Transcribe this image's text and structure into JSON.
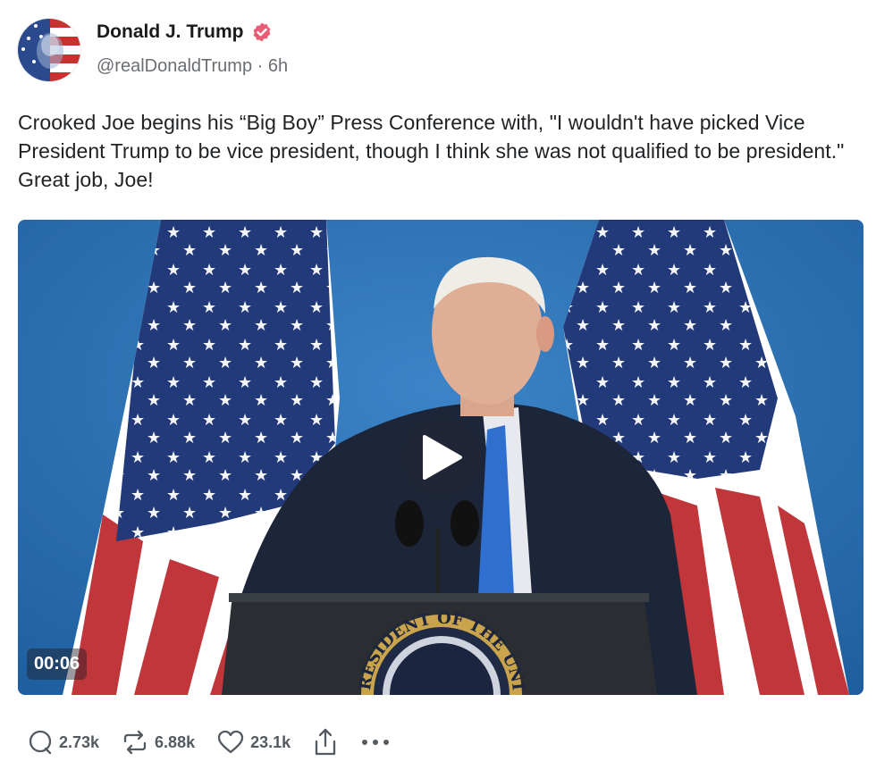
{
  "post": {
    "author_name": "Donald J. Trump",
    "handle": "@realDonaldTrump",
    "separator": "·",
    "time_ago": "6h",
    "text": "Crooked Joe begins his “Big Boy” Press Conference with, \"I wouldn't have picked Vice President Trump to be vice president, though I think she was not qualified to be president.\" Great job, Joe!",
    "video": {
      "duration": "00:06",
      "seal_text": "RESIDENT OF THE UNI"
    },
    "stats": {
      "replies": "2.73k",
      "reposts": "6.88k",
      "likes": "23.1k"
    },
    "icons": {
      "reply": "comment-icon",
      "repost": "repost-icon",
      "like": "heart-icon",
      "share": "share-icon",
      "more": "more-icon",
      "verified": "verified-badge-icon",
      "play": "play-icon"
    },
    "colors": {
      "verified": "#e85d75",
      "muted_text": "#6a6e73",
      "backdrop_blue": "#2a6fb6"
    }
  }
}
